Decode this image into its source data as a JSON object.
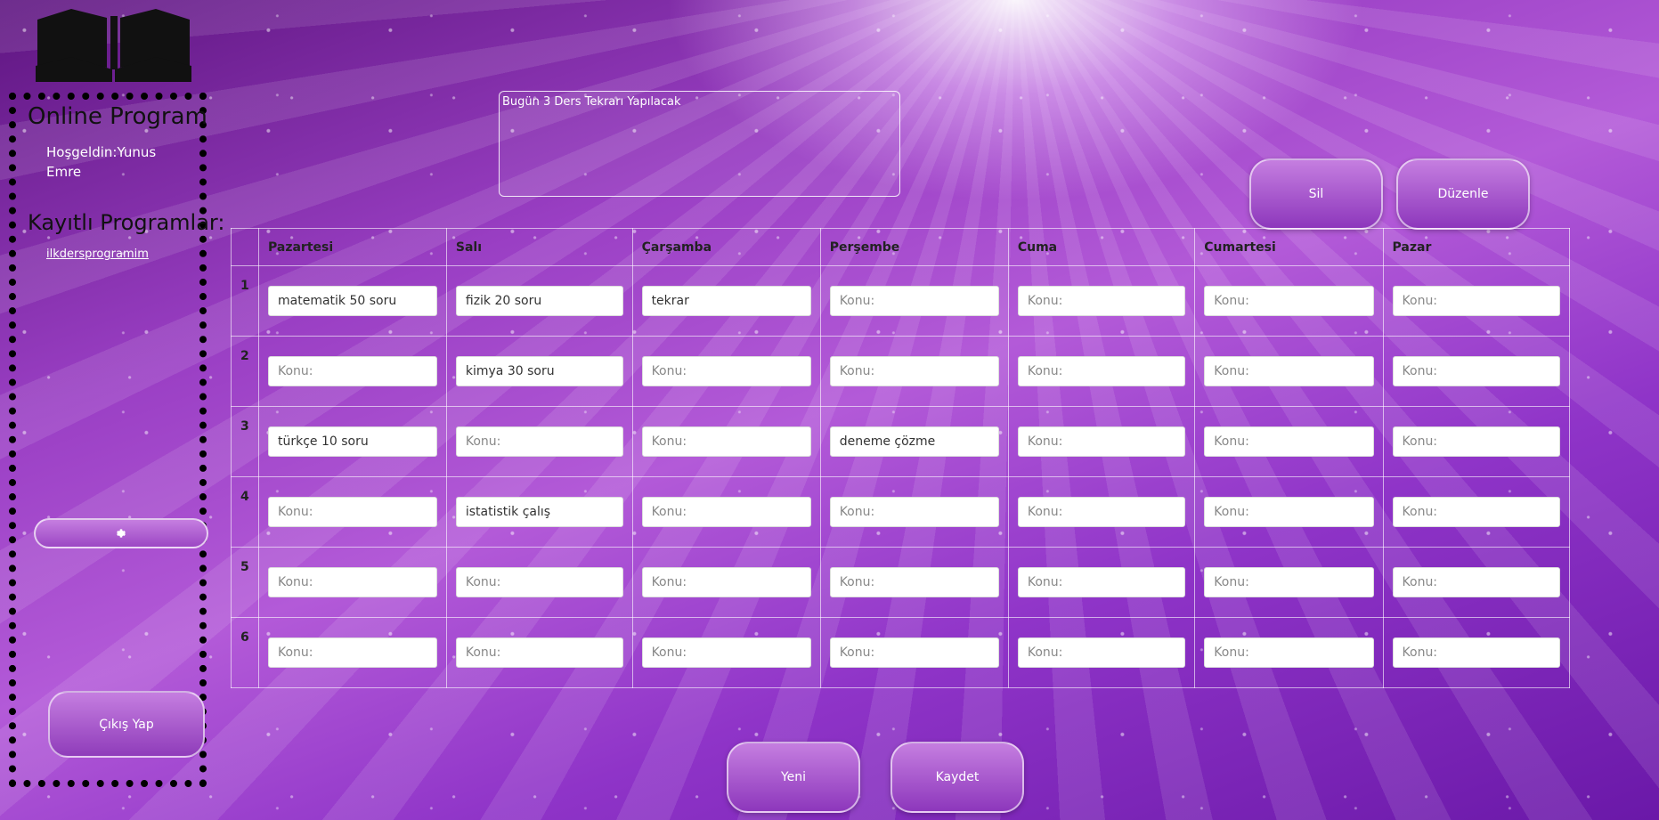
{
  "sidebar": {
    "app_title": "Online Program",
    "welcome": "Hoşgeldin:Yunus Emre",
    "saved_title": "Kayıtlı Programlar:",
    "saved_items": [
      "ilkdersprogramim"
    ],
    "logout_label": "Çıkış Yap",
    "settings_icon": "gear-icon"
  },
  "note": {
    "text": "Bugün 3 Ders Tekrarı Yapılacak"
  },
  "actions": {
    "delete_label": "Sil",
    "edit_label": "Düzenle",
    "new_label": "Yeni",
    "save_label": "Kaydet"
  },
  "schedule": {
    "placeholder": "Konu:",
    "days": [
      "Pazartesi",
      "Salı",
      "Çarşamba",
      "Perşembe",
      "Cuma",
      "Cumartesi",
      "Pazar"
    ],
    "rows": [
      {
        "num": "1",
        "cells": [
          "matematik 50 soru",
          "fizik 20 soru",
          "tekrar",
          "",
          "",
          "",
          ""
        ]
      },
      {
        "num": "2",
        "cells": [
          "",
          "kimya 30 soru",
          "",
          "",
          "",
          "",
          ""
        ]
      },
      {
        "num": "3",
        "cells": [
          "türkçe 10 soru",
          "",
          "",
          "deneme çözme",
          "",
          "",
          ""
        ]
      },
      {
        "num": "4",
        "cells": [
          "",
          "istatistik çalış",
          "",
          "",
          "",
          "",
          ""
        ]
      },
      {
        "num": "5",
        "cells": [
          "",
          "",
          "",
          "",
          "",
          "",
          ""
        ]
      },
      {
        "num": "6",
        "cells": [
          "",
          "",
          "",
          "",
          "",
          "",
          ""
        ]
      }
    ]
  }
}
